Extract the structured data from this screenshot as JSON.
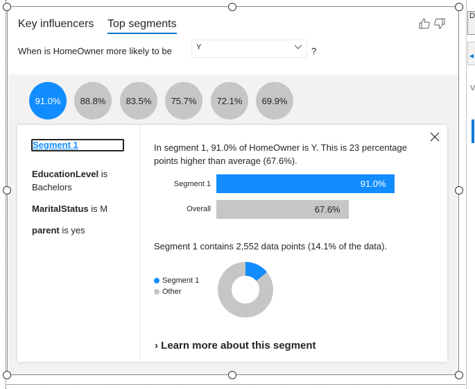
{
  "tabs": [
    {
      "label": "Key influencers",
      "active": false
    },
    {
      "label": "Top segments",
      "active": true
    }
  ],
  "question": {
    "prefix": "When is HomeOwner more likely to be",
    "selected_value": "Y",
    "suffix": "?"
  },
  "icons": {
    "thumbs_up": "thumbs-up-icon",
    "thumbs_down": "thumbs-down-icon",
    "dropdown": "chevron-down-icon",
    "close": "close-icon",
    "learn_more": "chevron-right-icon"
  },
  "segments": [
    {
      "label": "91.0%",
      "active": true
    },
    {
      "label": "88.8%",
      "active": false
    },
    {
      "label": "83.5%",
      "active": false
    },
    {
      "label": "75.7%",
      "active": false
    },
    {
      "label": "72.1%",
      "active": false
    },
    {
      "label": "69.9%",
      "active": false
    }
  ],
  "card": {
    "segment_title": "Segment 1",
    "conditions": [
      {
        "field": "EducationLevel",
        "op": "is",
        "value": "Bachelors"
      },
      {
        "field": "MaritalStatus",
        "op": "is",
        "value": "M"
      },
      {
        "field": "parent",
        "op": "is",
        "value": "yes"
      }
    ],
    "description": "In segment 1, 91.0% of HomeOwner is Y. This is 23 percentage points higher than average (67.6%).",
    "contains_text": "Segment 1 contains 2,552 data points (14.1% of the data).",
    "learn_more": "Learn more about this segment"
  },
  "chart_data": [
    {
      "type": "bar",
      "categories": [
        "Segment 1",
        "Overall"
      ],
      "values": [
        91.0,
        67.6
      ],
      "value_labels": [
        "91.0%",
        "67.6%"
      ],
      "colors": [
        "#118dff",
        "#c8c6c4"
      ]
    },
    {
      "type": "pie",
      "donut": true,
      "categories": [
        "Segment 1",
        "Other"
      ],
      "values": [
        14.1,
        85.9
      ],
      "colors": [
        "#118dff",
        "#c8c6c4"
      ],
      "legend_position": "left"
    }
  ],
  "colors": {
    "accent": "#118dff",
    "tab_underline": "#0078d4",
    "neutral_bar": "#c8c6c4",
    "band_background": "#f3f2f1"
  }
}
